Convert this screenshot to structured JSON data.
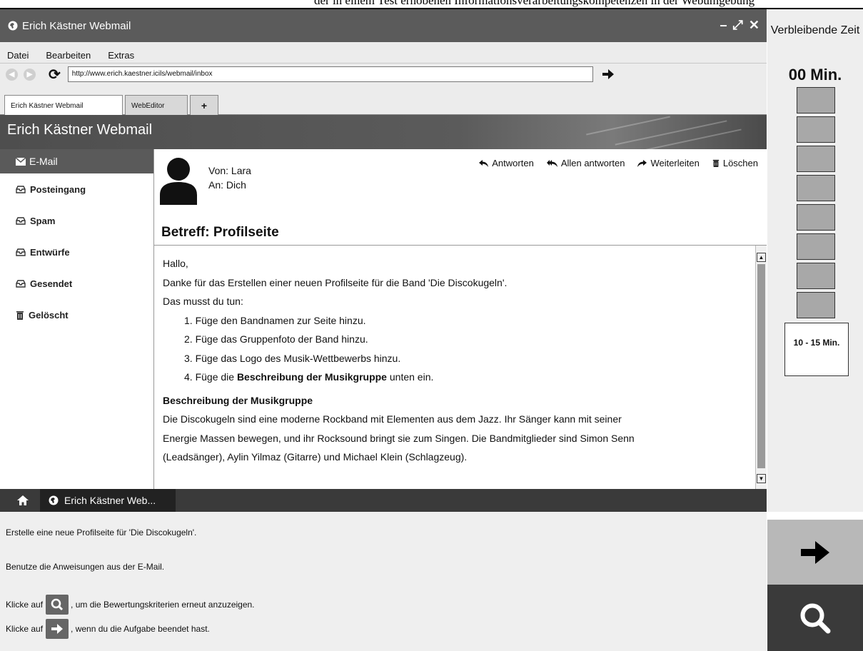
{
  "page_header_cut": "der in einem Test erhobenen Informationsverarbeitungskompetenzen in der Webumgebung",
  "window": {
    "title": "Erich Kästner Webmail",
    "controls": [
      "–",
      "⤢",
      "✕"
    ]
  },
  "menu": [
    "Datei",
    "Bearbeiten",
    "Extras"
  ],
  "address": {
    "url": "http://www.erich.kaestner.icils/webmail/inbox"
  },
  "tabs": [
    {
      "label": "Erich Kästner Webmail"
    },
    {
      "label": "WebEditor"
    },
    {
      "label": "+"
    }
  ],
  "banner_title": "Erich Kästner Webmail",
  "sidebar": {
    "header": "E-Mail",
    "items": [
      {
        "label": "Posteingang"
      },
      {
        "label": "Spam"
      },
      {
        "label": "Entwürfe"
      },
      {
        "label": "Gesendet"
      },
      {
        "label": "Gelöscht"
      }
    ]
  },
  "mail": {
    "from": "Von:  Lara",
    "to": "An:  Dich",
    "actions": [
      "Antworten",
      "Allen antworten",
      "Weiterleiten",
      "Löschen"
    ],
    "subject": "Betreff: Profilseite",
    "greeting": "Hallo,",
    "line1": "Danke für das Erstellen einer neuen Profilseite für die Band 'Die Discokugeln'.",
    "line2": "Das musst du tun:",
    "steps": [
      "1. Füge den Bandnamen zur Seite hinzu.",
      "2. Füge das Gruppenfoto der Band hinzu.",
      "3. Füge das Logo des Musik-Wettbewerbs hinzu."
    ],
    "step4_pre": "4. Füge die ",
    "step4_bold": "Beschreibung der Musikgruppe",
    "step4_post": " unten ein.",
    "desc_heading": "Beschreibung der Musikgruppe",
    "desc_lines": [
      "Die Discokugeln sind eine moderne Rockband mit Elementen aus dem Jazz. Ihr Sänger kann mit seiner",
      "Energie Massen bewegen, und ihr Rocksound bringt sie zum Singen. Die Bandmitglieder sind Simon Senn",
      "(Leadsänger), Aylin Yilmaz (Gitarre) und Michael Klein (Schlagzeug)."
    ]
  },
  "taskbar": {
    "tab_label": "Erich Kästner Web..."
  },
  "instructions": {
    "line1": "Erstelle eine neue Profilseite für 'Die Discokugeln'.",
    "line2": "Benutze die Anweisungen aus der E-Mail.",
    "line3_pre": "Klicke auf",
    "line3_post": ", um die Bewertungskriterien erneut anzuzeigen.",
    "line4_pre": "Klicke auf",
    "line4_post": ", wenn du die Aufgabe beendet hast."
  },
  "timer": {
    "label": "Verbleibende Zeit",
    "remaining": "00 Min.",
    "blocks_total": 8,
    "estimate": "10 - 15 Min."
  },
  "colors": {
    "titlebar": "#5b5b5b",
    "taskbar": "#3a3a3a",
    "panel": "#efefef"
  }
}
